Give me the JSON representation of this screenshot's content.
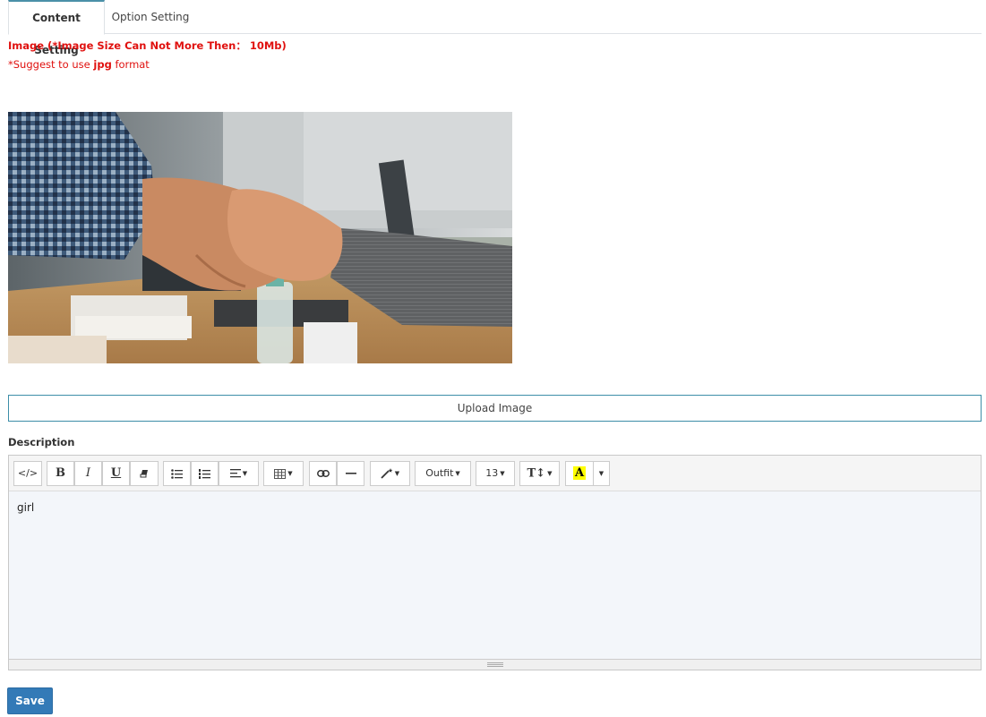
{
  "tabs": [
    {
      "label": "Content Setting",
      "active": true
    },
    {
      "label": "Option Setting",
      "active": false
    }
  ],
  "image_warning": "Image (*Image Size Can Not More Then： 10Mb)",
  "format_hint": {
    "prefix": "*Suggest to use ",
    "format": "jpg",
    "suffix": " format"
  },
  "upload_button_label": "Upload Image",
  "description_label": "Description",
  "editor": {
    "toolbar": {
      "code_view": "</>",
      "bold": "B",
      "italic": "I",
      "underline": "U",
      "font_family": "Outfit",
      "font_size": "13",
      "line_height": "T↕",
      "color": "A"
    },
    "content": "girl"
  },
  "save_button_label": "Save",
  "colors": {
    "warning": "#e0110f",
    "primary": "#337ab7",
    "tab_accent": "#4a90a8",
    "editor_bg": "#f3f6fa"
  }
}
